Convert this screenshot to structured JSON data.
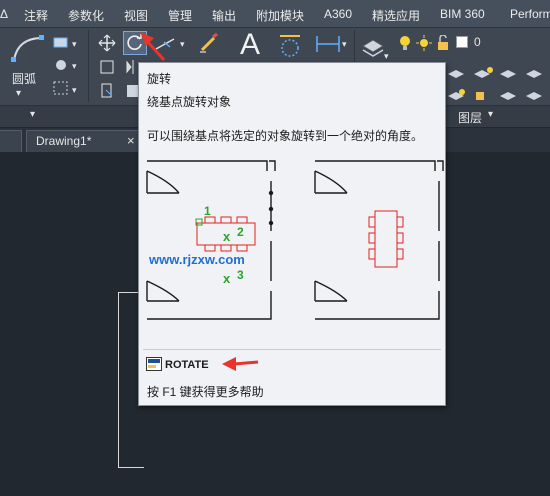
{
  "menu": {
    "items": [
      "注释",
      "参数化",
      "视图",
      "管理",
      "输出",
      "附加模块",
      "A360",
      "精选应用",
      "BIM 360",
      "Perform"
    ]
  },
  "ribbon": {
    "arc_label": "圆弧",
    "text_glyph": "A",
    "layer_value": "0",
    "layers_panel_label": "图层",
    "panel_dropdown_glyph": "▾"
  },
  "tabs": {
    "doc_tab_label": "Drawing1*",
    "close_glyph": "×"
  },
  "tooltip": {
    "title": "旋转",
    "subtitle": "绕基点旋转对象",
    "description": "可以围绕基点将选定的对象旋转到一个绝对的角度。",
    "figure": {
      "point_labels": [
        "1",
        "2",
        "3"
      ],
      "cross_glyph": "x",
      "watermark": "www.rjzxw.com"
    },
    "command_name": "ROTATE",
    "help_text": "按 F1 键获得更多帮助"
  },
  "colors": {
    "accent_red": "#e8342a",
    "figure_red": "#e02020",
    "figure_green": "#2aa62a",
    "watermark_blue": "#1f6fd6"
  }
}
